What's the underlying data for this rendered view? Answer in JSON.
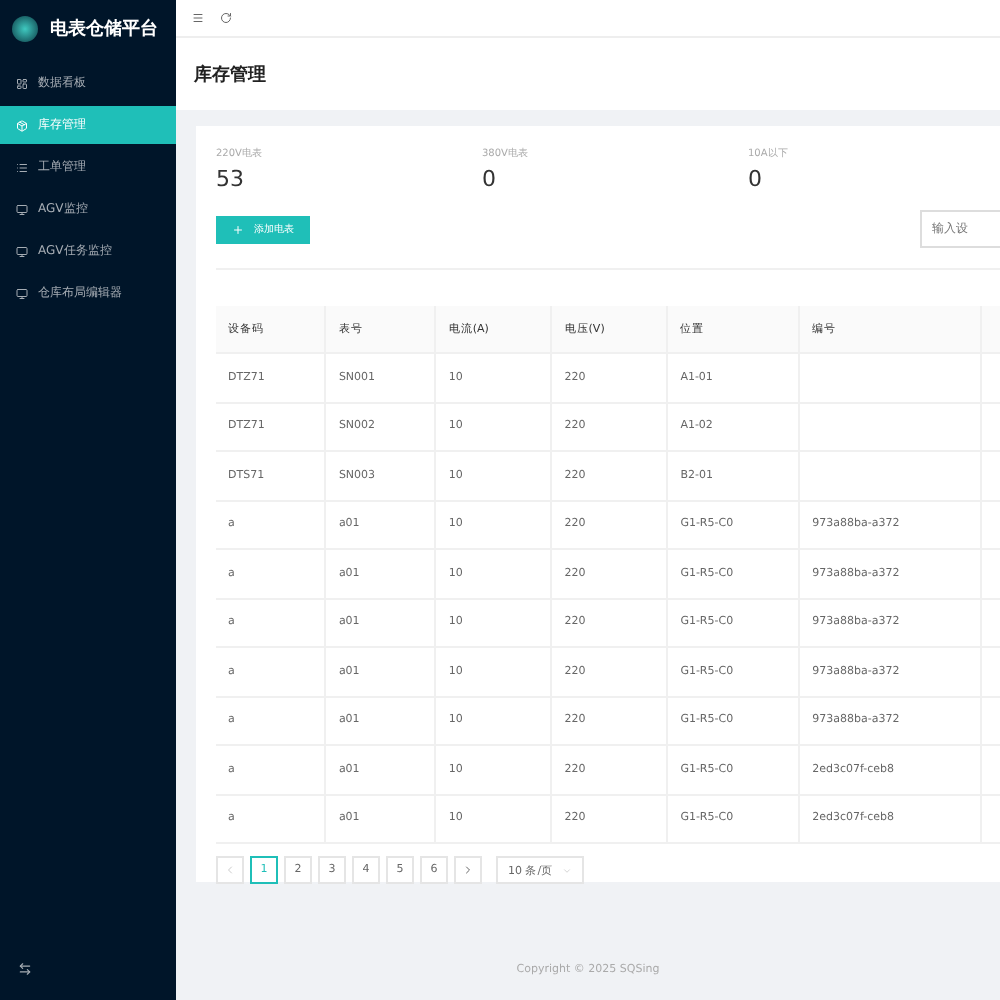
{
  "sidebar": {
    "title": "电表仓储平台",
    "items": [
      {
        "label": "数据看板",
        "selected": false
      },
      {
        "label": "库存管理",
        "selected": true
      },
      {
        "label": "工单管理",
        "selected": false
      },
      {
        "label": "AGV监控",
        "selected": false
      },
      {
        "label": "AGV任务监控",
        "selected": false
      },
      {
        "label": "仓库布局编辑器",
        "selected": false
      }
    ]
  },
  "page_title": "库存管理",
  "stats": [
    {
      "label": "220V电表",
      "value": "53"
    },
    {
      "label": "380V电表",
      "value": "0"
    },
    {
      "label": "10A以下",
      "value": "0"
    }
  ],
  "add_button": "添加电表",
  "search": {
    "placeholder": "输入设"
  },
  "table": {
    "columns": [
      "设备码",
      "表号",
      "电流(A)",
      "电压(V)",
      "位置",
      "编号"
    ],
    "rows": [
      [
        "DTZ71",
        "SN001",
        "10",
        "220",
        "A1-01",
        ""
      ],
      [
        "DTZ71",
        "SN002",
        "10",
        "220",
        "A1-02",
        ""
      ],
      [
        "DTS71",
        "SN003",
        "10",
        "220",
        "B2-01",
        ""
      ],
      [
        "a",
        "a01",
        "10",
        "220",
        "G1-R5-C0",
        "973a88ba-a372"
      ],
      [
        "a",
        "a01",
        "10",
        "220",
        "G1-R5-C0",
        "973a88ba-a372"
      ],
      [
        "a",
        "a01",
        "10",
        "220",
        "G1-R5-C0",
        "973a88ba-a372"
      ],
      [
        "a",
        "a01",
        "10",
        "220",
        "G1-R5-C0",
        "973a88ba-a372"
      ],
      [
        "a",
        "a01",
        "10",
        "220",
        "G1-R5-C0",
        "973a88ba-a372"
      ],
      [
        "a",
        "a01",
        "10",
        "220",
        "G1-R5-C0",
        "2ed3c07f-ceb8"
      ],
      [
        "a",
        "a01",
        "10",
        "220",
        "G1-R5-C0",
        "2ed3c07f-ceb8"
      ]
    ]
  },
  "pagination": {
    "pages": [
      {
        "label": "1",
        "selected": true
      },
      {
        "label": "2",
        "selected": false
      },
      {
        "label": "3",
        "selected": false
      },
      {
        "label": "4",
        "selected": false
      },
      {
        "label": "5",
        "selected": false
      },
      {
        "label": "6",
        "selected": false
      }
    ],
    "page_size": "10 条/页"
  },
  "footer": "Copyright © 2025 SQSing"
}
